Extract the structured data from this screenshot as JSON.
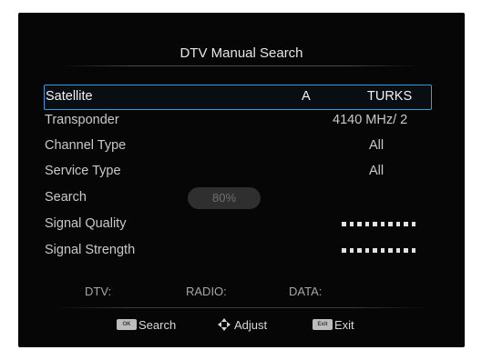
{
  "dialog": {
    "title": "DTV Manual Search"
  },
  "rows": {
    "satellite": {
      "label": "Satellite",
      "value_a": "A",
      "value_b": "TURKS"
    },
    "transponder": {
      "label": "Transponder",
      "value": "4140 MHz/ 2"
    },
    "channel_type": {
      "label": "Channel Type",
      "value": "All"
    },
    "service_type": {
      "label": "Service Type",
      "value": "All"
    },
    "search": {
      "label": "Search",
      "progress_text": "80%",
      "progress": 0.8
    },
    "signal_quality": {
      "label": "Signal Quality",
      "level_dots": 10
    },
    "signal_strength": {
      "label": "Signal Strength",
      "level_dots": 10
    }
  },
  "counts": {
    "dtv": "DTV:",
    "radio": "RADIO:",
    "data": "DATA:"
  },
  "footer": {
    "search_key": "OK",
    "search_label": "Search",
    "adjust_label": "Adjust",
    "exit_key": "Exit",
    "exit_label": "Exit"
  },
  "colors": {
    "background": "#060606",
    "selection_border": "#3a9ad9",
    "text": "#c9c9c9"
  },
  "icons": {
    "adjust": "dpad-arrows-icon"
  }
}
